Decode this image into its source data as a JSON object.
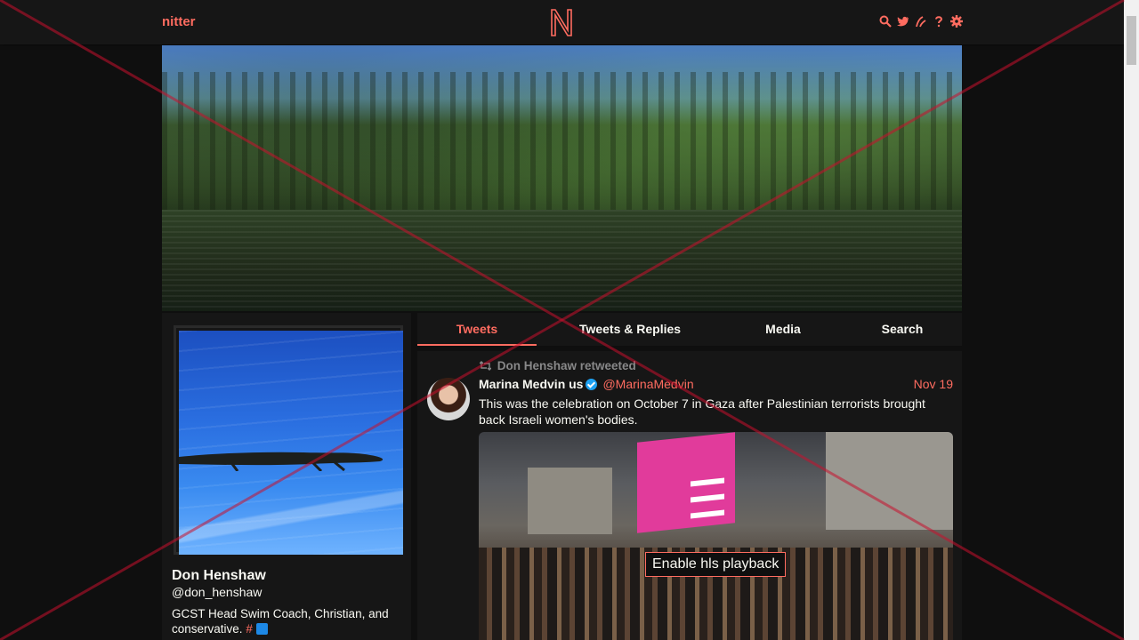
{
  "navbar": {
    "brand": "nitter",
    "logo_letter": "N",
    "icons": [
      "search-icon",
      "twitter-icon",
      "rss-icon",
      "help-icon",
      "settings-icon"
    ]
  },
  "banner": {
    "alt": ""
  },
  "profile": {
    "fullname": "Don Henshaw",
    "username": "@don_henshaw",
    "bio_text": "GCST Head Swim Coach, Christian, and conservative.",
    "bio_hash": "#"
  },
  "tabs": [
    {
      "label": "Tweets",
      "active": true
    },
    {
      "label": "Tweets & Replies",
      "active": false
    },
    {
      "label": "Media",
      "active": false
    },
    {
      "label": "Search",
      "active": false
    }
  ],
  "tweet": {
    "retweet_header": "Don Henshaw retweeted",
    "author_name": "Marina Medvin us",
    "author_handle": "@MarinaMedvin",
    "date": "Nov 19",
    "text": "This was the celebration on October 7 in Gaza after Palestinian terrorists brought back Israeli women's bodies.",
    "media_button": "Enable hls playback"
  },
  "colors": {
    "accent": "#ff6c60",
    "background": "#0f0f0f",
    "panel": "#161616",
    "overlay_cross": "#c8102e"
  }
}
